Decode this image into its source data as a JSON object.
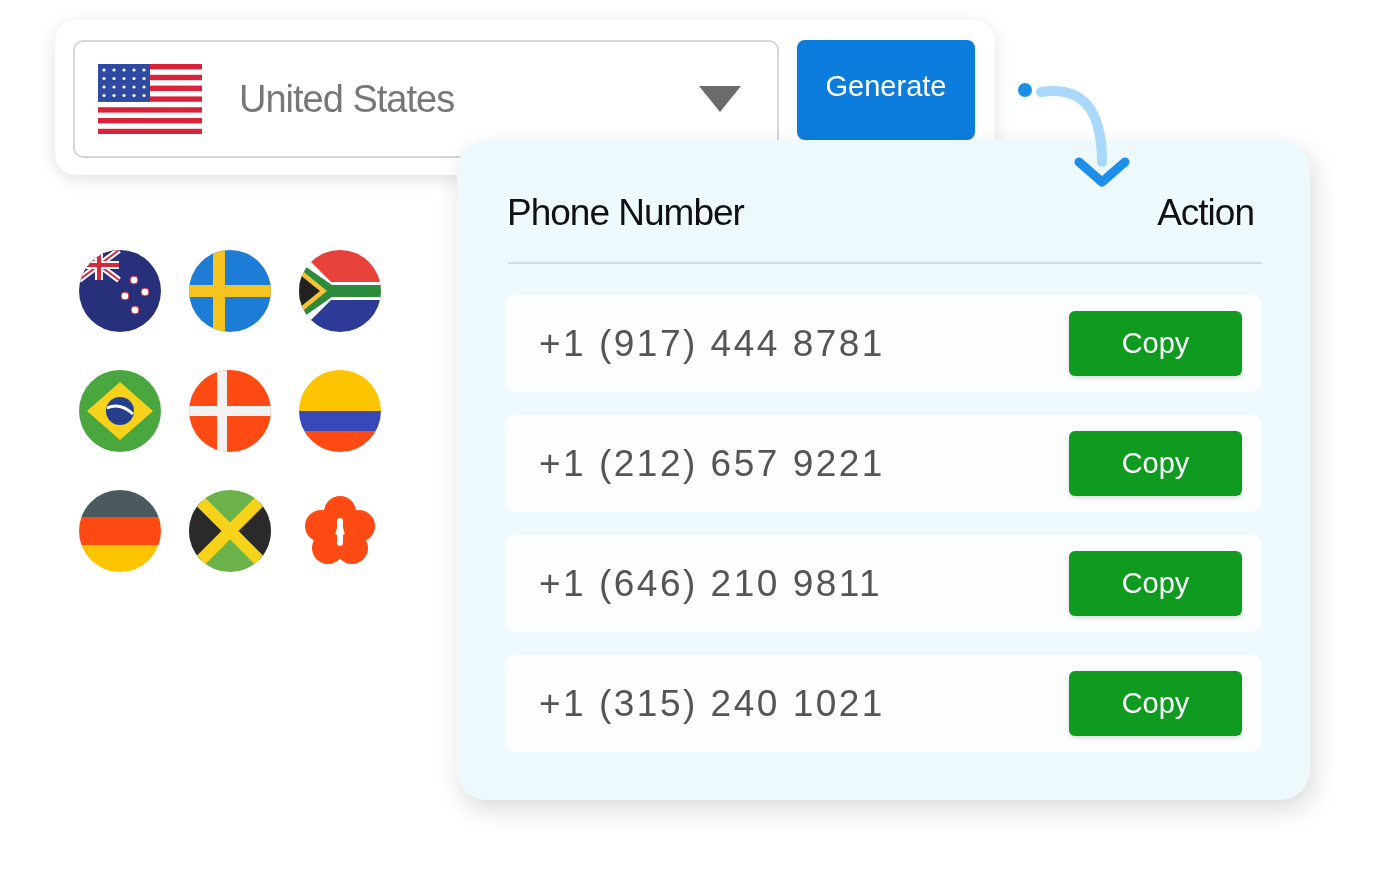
{
  "country_select": {
    "value": "United States"
  },
  "generate_button": {
    "label": "Generate"
  },
  "table": {
    "columns": [
      "Phone Number",
      "Action"
    ],
    "rows": [
      {
        "phone": "+1 (917) 444 8781",
        "action": "Copy"
      },
      {
        "phone": "+1 (212) 657 9221",
        "action": "Copy"
      },
      {
        "phone": "+1 (646) 210 9811",
        "action": "Copy"
      },
      {
        "phone": "+1 (315) 240 1021",
        "action": "Copy"
      }
    ]
  }
}
